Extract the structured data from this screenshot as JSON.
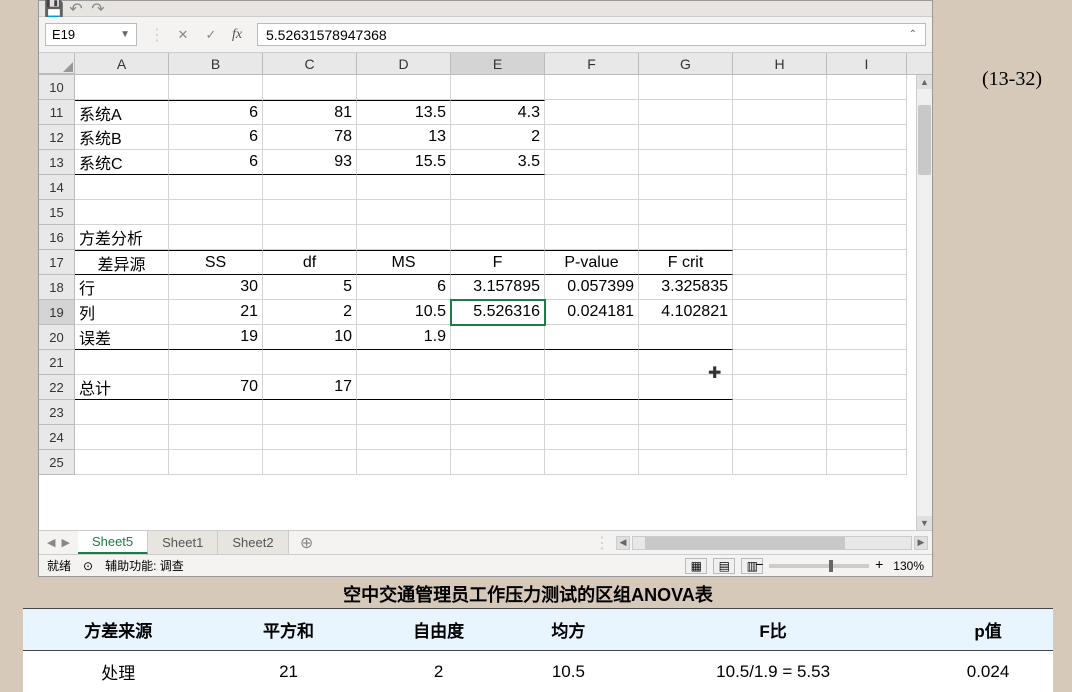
{
  "page_ref": "(13-32)",
  "qat": {
    "save": "💾",
    "undo": "↶",
    "redo": "↷"
  },
  "formula_bar": {
    "name_box": "E19",
    "cancel": "✕",
    "confirm": "✓",
    "fx": "fx",
    "value": "5.52631578947368"
  },
  "columns": [
    "A",
    "B",
    "C",
    "D",
    "E",
    "F",
    "G",
    "H",
    "I"
  ],
  "rows": [
    10,
    11,
    12,
    13,
    14,
    15,
    16,
    17,
    18,
    19,
    20,
    21,
    22,
    23,
    24,
    25
  ],
  "selected_cell": {
    "row": 19,
    "col": "E"
  },
  "grid": {
    "r11": {
      "A": "系统A",
      "B": "6",
      "C": "81",
      "D": "13.5",
      "E": "4.3"
    },
    "r12": {
      "A": "系统B",
      "B": "6",
      "C": "78",
      "D": "13",
      "E": "2"
    },
    "r13": {
      "A": "系统C",
      "B": "6",
      "C": "93",
      "D": "15.5",
      "E": "3.5"
    },
    "r16": {
      "A": "方差分析"
    },
    "r17": {
      "A": "差异源",
      "B": "SS",
      "C": "df",
      "D": "MS",
      "E": "F",
      "F": "P-value",
      "G": "F crit"
    },
    "r18": {
      "A": "行",
      "B": "30",
      "C": "5",
      "D": "6",
      "E": "3.157895",
      "F": "0.057399",
      "G": "3.325835"
    },
    "r19": {
      "A": "列",
      "B": "21",
      "C": "2",
      "D": "10.5",
      "E": "5.526316",
      "F": "0.024181",
      "G": "4.102821"
    },
    "r20": {
      "A": "误差",
      "B": "19",
      "C": "10",
      "D": "1.9"
    },
    "r22": {
      "A": "总计",
      "B": "70",
      "C": "17"
    }
  },
  "tabs": {
    "active": "Sheet5",
    "t1": "Sheet1",
    "t2": "Sheet2",
    "add": "⊕"
  },
  "status": {
    "ready": "就绪",
    "accessibility_icon": "⊙",
    "accessibility": "辅助功能: 调查",
    "zoom": "130%"
  },
  "caption": "空中交通管理员工作压力测试的区组ANOVA表",
  "ext_header": {
    "h1": "方差来源",
    "h2": "平方和",
    "h3": "自由度",
    "h4": "均方",
    "h5": "F比",
    "h6": "p值"
  },
  "ext_row1": {
    "c1": "处理",
    "c2": "21",
    "c3": "2",
    "c4": "10.5",
    "c5": "10.5/1.9 = 5.53",
    "c6": "0.024"
  }
}
